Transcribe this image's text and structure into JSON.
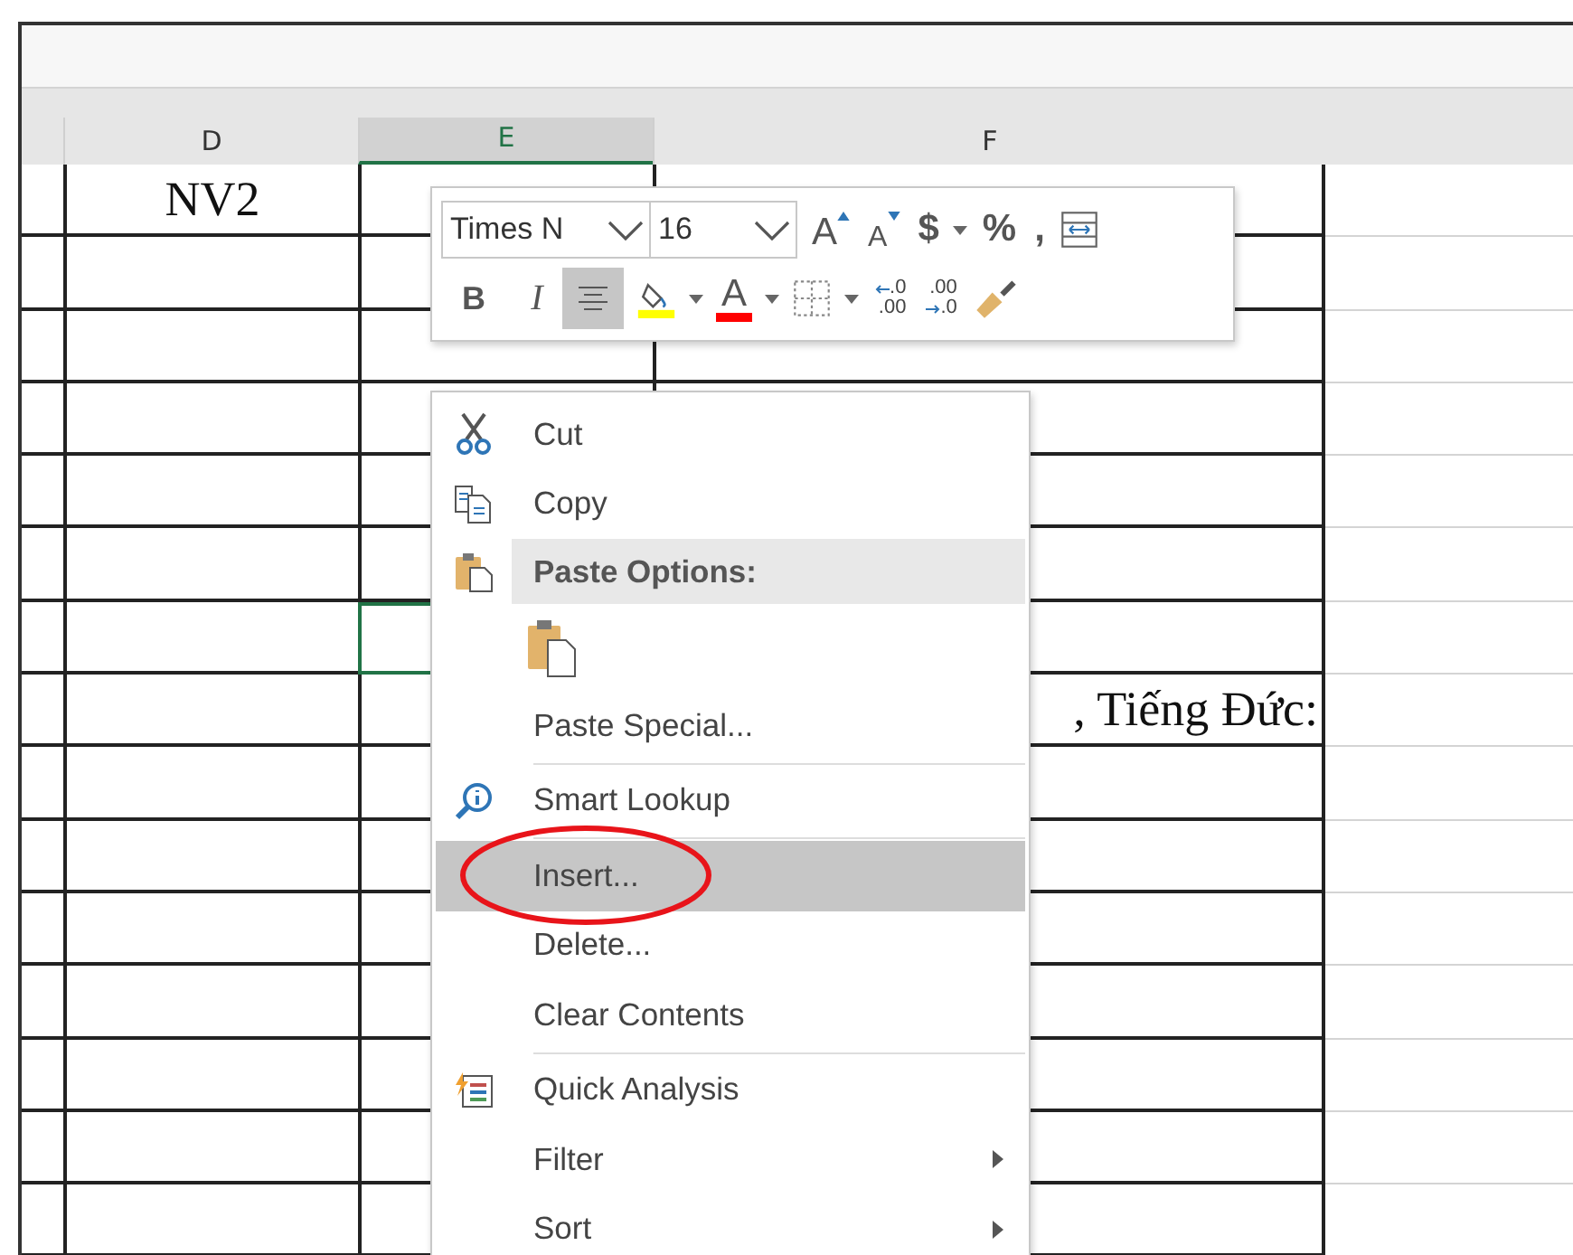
{
  "sheet": {
    "columns": [
      {
        "label": "D",
        "selected": false
      },
      {
        "label": "E",
        "selected": true
      },
      {
        "label": "F",
        "selected": false
      }
    ],
    "rows": [
      {
        "column_d": "NV2",
        "selected": false
      },
      {
        "selected": false
      },
      {
        "selected": false
      },
      {
        "selected": false
      },
      {
        "selected": false
      },
      {
        "selected": false
      },
      {
        "selected": true
      },
      {
        "column_f": ", Tiếng Đức:",
        "selected": false
      },
      {
        "selected": false
      },
      {
        "selected": false
      },
      {
        "selected": false
      },
      {
        "selected": false
      },
      {
        "selected": false
      },
      {
        "selected": false
      },
      {
        "selected": false
      }
    ]
  },
  "mini_toolbar": {
    "font": "Times N",
    "size": "16",
    "row_1": [
      {
        "kind": "grow",
        "label": "A"
      },
      {
        "kind": "shrink",
        "label": "A"
      },
      {
        "kind": "currency",
        "label": "$",
        "dropdown": true
      },
      {
        "kind": "percent",
        "label": "%"
      },
      {
        "kind": "comma",
        "label": ","
      },
      {
        "kind": "wrap"
      }
    ],
    "row_2": [
      {
        "kind": "bold",
        "label": "B",
        "on": false
      },
      {
        "kind": "italic",
        "label": "I",
        "on": false
      },
      {
        "kind": "center",
        "on": true
      },
      {
        "kind": "fill",
        "color": "#ffff00",
        "dropdown": true
      },
      {
        "kind": "fontcolor",
        "label": "A",
        "color": "#ff0000",
        "dropdown": true
      },
      {
        "kind": "borders",
        "dropdown": true
      },
      {
        "kind": "incdec",
        "top": ".0",
        "bottom": ".00"
      },
      {
        "kind": "decdec",
        "top": ".00",
        "bottom": ".0"
      },
      {
        "kind": "painter"
      }
    ]
  },
  "context_menu": [
    {
      "kind": "cut",
      "label": "Cut",
      "selected": false
    },
    {
      "kind": "copy",
      "label": "Copy",
      "selected": false
    },
    {
      "kind": "header",
      "label": "Paste Options:"
    },
    {
      "kind": "paste"
    },
    {
      "kind": "plain",
      "label": "Paste Special...",
      "selected": false
    },
    {
      "kind": "separator"
    },
    {
      "kind": "lookup",
      "label": "Smart Lookup",
      "selected": false
    },
    {
      "kind": "separator"
    },
    {
      "kind": "plain",
      "label": "Insert...",
      "selected": true,
      "circled": true
    },
    {
      "kind": "plain",
      "label": "Delete...",
      "selected": false
    },
    {
      "kind": "plain",
      "label": "Clear Contents",
      "selected": false
    },
    {
      "kind": "separator"
    },
    {
      "kind": "analysis",
      "label": "Quick Analysis",
      "selected": false
    },
    {
      "kind": "plain",
      "label": "Filter",
      "selected": false,
      "submenu": true
    },
    {
      "kind": "plain",
      "label": "Sort",
      "selected": false,
      "submenu": true
    }
  ]
}
